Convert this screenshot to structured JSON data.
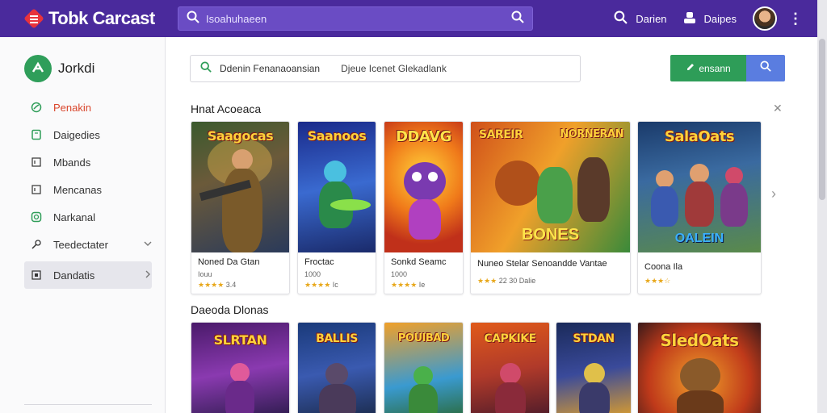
{
  "app": {
    "title": "Tobk Carcast"
  },
  "topbar": {
    "search_placeholder": "Isoahuhaeen",
    "link1_label": "Darien",
    "link2_label": "Daipes"
  },
  "sidebar": {
    "brand": "Jorkdi",
    "items": [
      {
        "label": "Penakin",
        "icon": "leaf-icon"
      },
      {
        "label": "Daigedies",
        "icon": "book-icon"
      },
      {
        "label": "Mbands",
        "icon": "square-icon"
      },
      {
        "label": "Mencanas",
        "icon": "square-icon"
      },
      {
        "label": "Narkanal",
        "icon": "shield-icon"
      },
      {
        "label": "Teedectater",
        "icon": "wrench-icon"
      },
      {
        "label": "Dandatis",
        "icon": "square-icon"
      }
    ]
  },
  "filter": {
    "text1": "Ddenin Fenanaoansian",
    "text2": "Djeue Icenet Glekadlank"
  },
  "actions": {
    "green_label": "ensann"
  },
  "sections": {
    "first_title": "Hnat Acoeaca",
    "second_title": "Daeoda Dlonas"
  },
  "row1": [
    {
      "cover_title": "Saagocas",
      "name": "Noned Da Gtan",
      "sub": "Iouu",
      "rating": "3.4"
    },
    {
      "cover_title": "Saanoos",
      "name": "Froctac",
      "sub": "1000",
      "rating": "Ic"
    },
    {
      "cover_title": "DDAVG",
      "name": "Sonkd Seamc",
      "sub": "1000",
      "rating": "Ie"
    },
    {
      "cover_title": "SAREIR",
      "cover_title2": "NORNERAN",
      "cover_bottom": "BONES",
      "name": "Nuneo Stelar Senoandde Vantae",
      "rating": "22 30 Dalie"
    },
    {
      "cover_title": "SalaOats",
      "cover_bottom": "OALEIN",
      "name": "Coona Ila",
      "sub": "",
      "rating": ""
    }
  ],
  "row2": [
    {
      "cover_title": "SLRTAN"
    },
    {
      "cover_title": "BALLIS"
    },
    {
      "cover_title": "POUIBAD"
    },
    {
      "cover_title": "CAPKIKE"
    },
    {
      "cover_title": "STDAN"
    },
    {
      "cover_title": "SledOats"
    }
  ],
  "colors": {
    "topbar": "#4a2a9c",
    "accent_green": "#2e9d58",
    "accent_blue": "#5a7de0",
    "active_nav": "#d9452b"
  }
}
